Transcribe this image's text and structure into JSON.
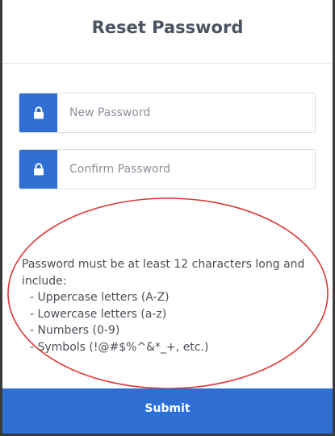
{
  "header": {
    "title": "Reset Password"
  },
  "fields": {
    "new_password": {
      "icon": "lock-icon",
      "placeholder": "New Password",
      "value": ""
    },
    "confirm_password": {
      "icon": "lock-icon",
      "placeholder": "Confirm Password",
      "value": ""
    }
  },
  "rules": {
    "intro": "Password must be at least 12 characters long and include:",
    "items": [
      "- Uppercase letters (A-Z)",
      "- Lowercase letters (a-z)",
      "- Numbers (0-9)",
      "- Symbols (!@#$%^&*_+, etc.)"
    ]
  },
  "submit": {
    "label": "Submit"
  },
  "colors": {
    "accent": "#2f6fd4",
    "title": "#4a5361",
    "annotation": "#e03535"
  }
}
